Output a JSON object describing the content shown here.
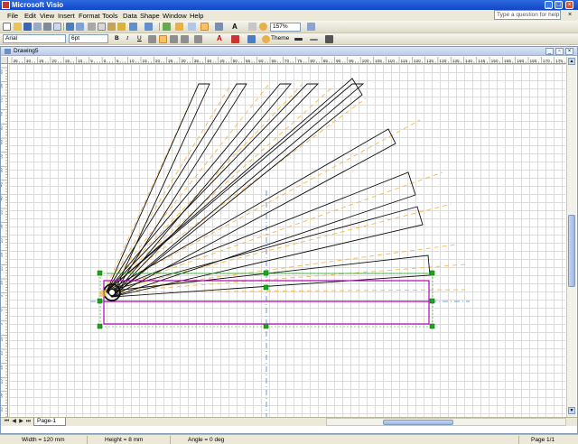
{
  "app": {
    "title": "Microsoft Visio"
  },
  "menu": {
    "items": [
      "File",
      "Edit",
      "View",
      "Insert",
      "Format",
      "Tools",
      "Data",
      "Shape",
      "Window",
      "Help"
    ],
    "help_placeholder": "Type a question for help",
    "close_glyph": "×"
  },
  "toolbar": {
    "zoom": "157%",
    "font": "Arial",
    "font_size": "6pt",
    "bold": "B",
    "italic": "I",
    "underline": "U",
    "theme_label": "Theme",
    "font_color_glyph": "A",
    "text_tool_glyph": "A"
  },
  "document": {
    "title": "Drawing5"
  },
  "rulers": {
    "h_labels": [
      "35",
      "30",
      "25",
      "20",
      "15",
      "10",
      "5",
      "0",
      "5",
      "10",
      "15",
      "20",
      "25",
      "30",
      "35",
      "40",
      "45",
      "50",
      "55",
      "60",
      "65",
      "70",
      "75",
      "80",
      "85",
      "90",
      "95",
      "100",
      "105",
      "110",
      "115",
      "120",
      "125",
      "130",
      "135",
      "140",
      "145",
      "150",
      "155",
      "160",
      "165",
      "170",
      "175"
    ],
    "v_labels": [
      "85",
      "80",
      "75",
      "70",
      "65",
      "60",
      "55",
      "50",
      "45",
      "40",
      "35",
      "30",
      "25",
      "20",
      "15",
      "10",
      "5",
      "0",
      "5",
      "10",
      "15",
      "20",
      "25",
      "30",
      "35"
    ]
  },
  "page_tabs": {
    "active": "Page-1"
  },
  "status": {
    "width": "Width = 120 mm",
    "height": "Height = 8 mm",
    "angle": "Angle = 0 deg",
    "page": "Page 1/1"
  },
  "colors": {
    "accent": "#1146c4",
    "selection": "#b400b4",
    "guide": "#f5b84a",
    "handle": "#1ca51c",
    "guide_axis": "#4a7cd6"
  }
}
